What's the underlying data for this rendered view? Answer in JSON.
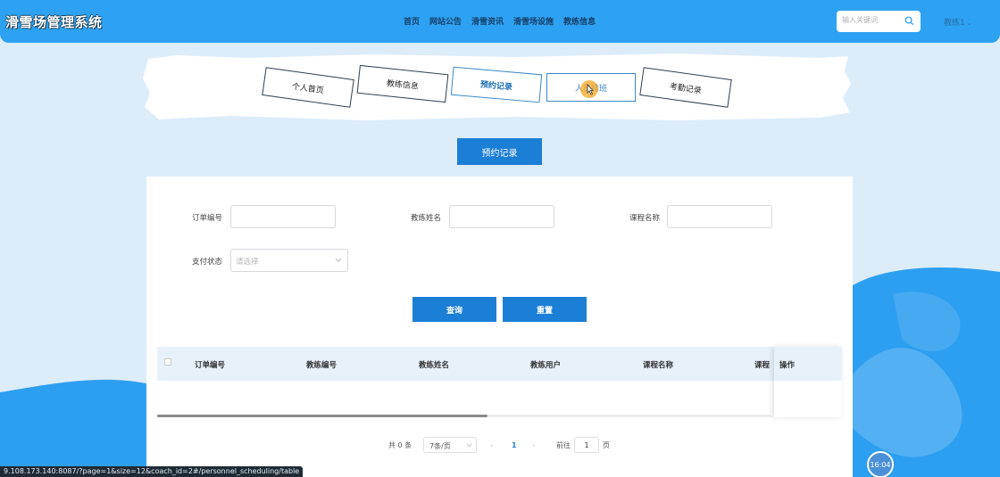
{
  "header": {
    "logo": "滑雪场管理系统",
    "nav": [
      "首页",
      "网站公告",
      "滑雪资讯",
      "滑雪场设施",
      "教练信息"
    ],
    "search_placeholder": "输入关键词",
    "user": "教练1"
  },
  "tabs": [
    "个人首页",
    "教练信息",
    "预约记录",
    "人员排班",
    "考勤记录"
  ],
  "section_title": "预约记录",
  "form": {
    "order_no_label": "订单编号",
    "coach_name_label": "教练姓名",
    "course_name_label": "课程名称",
    "pay_status_label": "支付状态",
    "pay_status_placeholder": "请选择",
    "query_button": "查询",
    "reset_button": "重置"
  },
  "table": {
    "columns": [
      "订单编号",
      "教练编号",
      "教练姓名",
      "教练用户",
      "课程名称",
      "课程"
    ],
    "fixed_column": "操作",
    "rows": []
  },
  "pagination": {
    "total": "共 0 条",
    "page_size": "7条/页",
    "current_page": "1",
    "goto_label": "前往",
    "goto_value": "1",
    "page_unit": "页"
  },
  "status_bar_url": "9.108.173.140:8087/?page=1&size=12&coach_id=2#/personnel_scheduling/table",
  "clock": "16:04",
  "colors": {
    "primary": "#2da2f2",
    "button": "#1c7fd6",
    "background": "#dcecf9"
  }
}
